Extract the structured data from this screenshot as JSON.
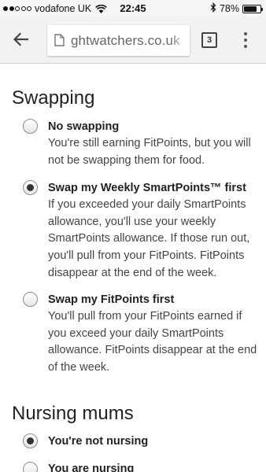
{
  "status_bar": {
    "carrier": "vodafone UK",
    "time": "22:45",
    "battery": "78%",
    "battery_level": 0.78,
    "icons": [
      "signal-dots-icon",
      "wifi-icon",
      "bluetooth-icon",
      "battery-icon"
    ]
  },
  "browser": {
    "back_icon": "arrow-left-icon",
    "page_icon": "document-icon",
    "url": "ghtwatchers.co.uk",
    "tab_count": "3",
    "menu_icon": "more-vert-icon"
  },
  "swapping": {
    "title": "Swapping",
    "options": [
      {
        "label": "No swapping",
        "description": "You're still earning FitPoints, but you will not be swapping them for food.",
        "selected": false
      },
      {
        "label": "Swap my Weekly SmartPoints™ first",
        "description": "If you exceeded your daily SmartPoints allowance, you'll use your weekly SmartPoints allowance. If those run out, you'll pull from your FitPoints. FitPoints disappear at the end of the week.",
        "selected": true
      },
      {
        "label": "Swap my FitPoints first",
        "description": "You'll pull from your FitPoints earned if you exceed your daily SmartPoints allowance. FitPoints disappear at the end of the week.",
        "selected": false
      }
    ]
  },
  "nursing": {
    "title": "Nursing mums",
    "options": [
      {
        "label": "You're not nursing",
        "selected": true
      },
      {
        "label": "You are nursing",
        "selected": false
      }
    ]
  }
}
